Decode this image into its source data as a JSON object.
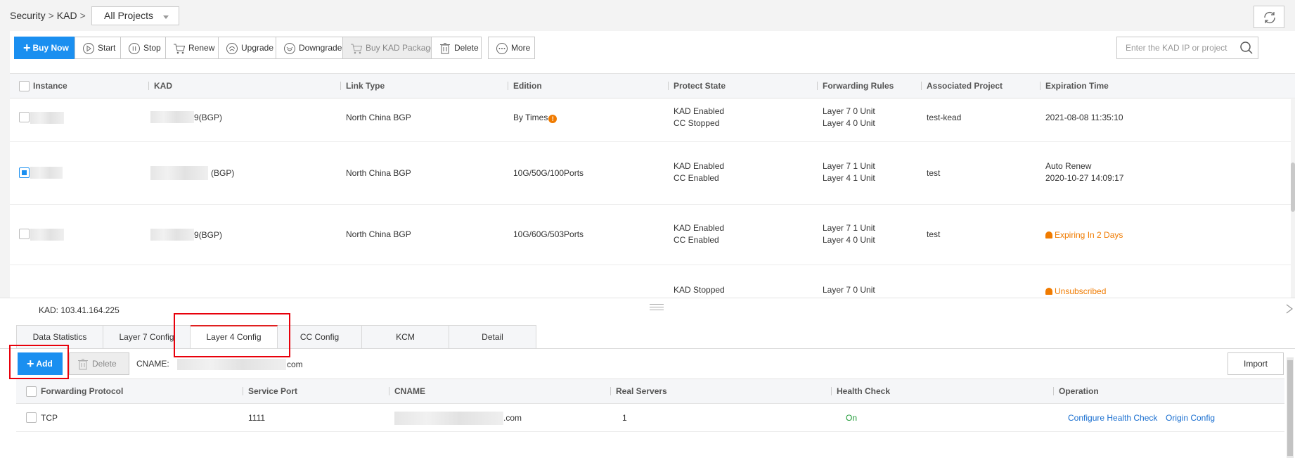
{
  "breadcrumb": {
    "items": [
      "Security",
      "KAD"
    ],
    "separator": ">"
  },
  "project_select": {
    "value": "All Projects"
  },
  "toolbar": {
    "buy_now": "Buy Now",
    "start": "Start",
    "stop": "Stop",
    "renew": "Renew",
    "upgrade": "Upgrade",
    "downgrade": "Downgrade",
    "buy_package": "Buy KAD Package",
    "delete": "Delete",
    "more": "More"
  },
  "search": {
    "placeholder": "Enter the KAD IP or project na"
  },
  "instances_table": {
    "columns": [
      "Instance",
      "KAD",
      "Link Type",
      "Edition",
      "Protect State",
      "Forwarding Rules",
      "Associated Project",
      "Expiration Time"
    ],
    "rows": [
      {
        "kad_suffix": "9(BGP)",
        "link_type": "North China BGP",
        "edition": "By Times",
        "protect": [
          "KAD Enabled",
          "CC Stopped"
        ],
        "rules": [
          "Layer 7 0 Unit",
          "Layer 4 0 Unit"
        ],
        "project": "test-kead",
        "expiration": [
          "2021-08-08 11:35:10"
        ],
        "checked": false
      },
      {
        "kad_suffix": "(BGP)",
        "link_type": "North China BGP",
        "edition": "10G/50G/100Ports",
        "protect": [
          "KAD Enabled",
          "CC Enabled"
        ],
        "rules": [
          "Layer 7 1 Unit",
          "Layer 4 1 Unit"
        ],
        "project": "test",
        "expiration": [
          "Auto Renew",
          "2020-10-27 14:09:17"
        ],
        "checked": true
      },
      {
        "kad_suffix": "9(BGP)",
        "link_type": "North China BGP",
        "edition": "10G/60G/503Ports",
        "protect": [
          "KAD Enabled",
          "CC Enabled"
        ],
        "rules": [
          "Layer 7 1 Unit",
          "Layer 4 0 Unit"
        ],
        "project": "test",
        "expiration": [
          "Expiring In 2 Days"
        ],
        "checked": false
      },
      {
        "kad_suffix": "",
        "link_type": "",
        "edition": "",
        "protect": [
          "KAD Stopped"
        ],
        "rules": [
          "Layer 7 0 Unit"
        ],
        "project": "",
        "expiration": [
          "Unsubscribed"
        ],
        "checked": false
      }
    ]
  },
  "detail": {
    "kad_label": "KAD: 103.41.164.225",
    "tabs": [
      "Data Statistics",
      "Layer 7 Config",
      "Layer 4 Config",
      "CC Config",
      "KCM",
      "Detail"
    ],
    "active_tab": "Layer 4 Config",
    "add_button": "Add",
    "delete_button": "Delete",
    "cname_label": "CNAME:",
    "cname_suffix": "com",
    "import_button": "Import",
    "rules_table": {
      "columns": [
        "Forwarding Protocol",
        "Service Port",
        "CNAME",
        "Real Servers",
        "Health Check",
        "Operation"
      ],
      "rows": [
        {
          "protocol": "TCP",
          "port": "1111",
          "cname_suffix": ".com",
          "real_servers": "1",
          "health_check": "On",
          "ops": [
            "Configure Health Check",
            "Origin Config"
          ]
        }
      ]
    }
  },
  "colors": {
    "primary": "#1a8ff0",
    "warning": "#f07b00",
    "highlight": "#e8000b",
    "link": "#1a6fd0",
    "success": "#1d9a35"
  }
}
